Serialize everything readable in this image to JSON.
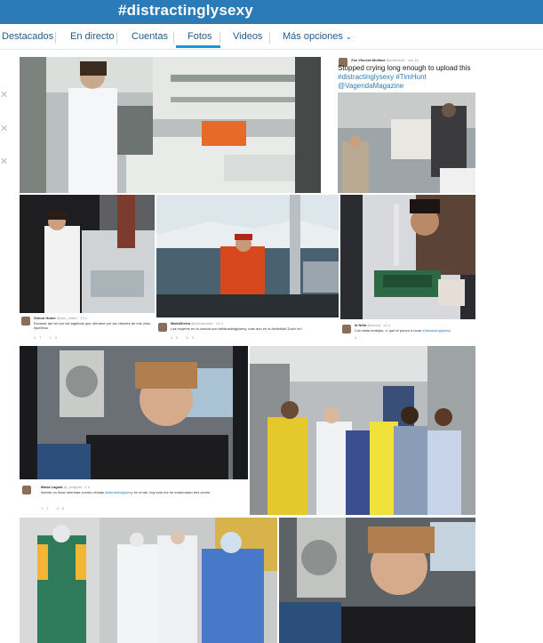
{
  "header": {
    "hashtag": "#distractinglysexy"
  },
  "tabs": [
    {
      "label": "Destacados"
    },
    {
      "label": "En directo"
    },
    {
      "label": "Cuentas"
    },
    {
      "label": "Fotos"
    },
    {
      "label": "Videos"
    },
    {
      "label": "Más opciones"
    }
  ],
  "active_tab": "Fotos",
  "gutter_icons": [
    "close-icon",
    "close-icon",
    "close-icon"
  ],
  "tweets": {
    "zoe": {
      "name": "Zoe Vincent-Mollase",
      "handle": "@zoebrenti · Jun 10",
      "text": "Stopped crying long enough to upload this",
      "tags": "#distractinglysexy #TimHunt",
      "mention": "@VagendaMagazine"
    },
    "simon": {
      "name": "Simon Huber",
      "handle": "@sim_huber · 13 h",
      "text": "Escaner tan bit con las lagrimas que derrame por las virtudes de mis virus hipefinos",
      "counts": "37  14"
    },
    "marta": {
      "name": "MartaSierra",
      "handle": "@sierramarta · 21 h",
      "text": "Las mujeres en la ciencia son #distractinglysexy, más aún en la Antártida! Doch on!",
      "counts": "46  53"
    },
    "la_nina": {
      "name": "la Niña",
      "handle": "@lanina · 21 h",
      "text": "Con tanta lentejas, a' que te ponen a tocar",
      "tag": "#distractinglysexy",
      "counts": "4"
    },
    "maria": {
      "name": "María Laguía",
      "handle": "@_mlaguia · 6 h",
      "text": "Intento no llorar mientras cuento células",
      "tag": "#distractinglysexy",
      "text2": "en el lab, hoy solo me he enamorado tres veces.",
      "counts": "17  36"
    }
  },
  "colors": {
    "header_bg": "#2b7bb9",
    "tab_text": "#1b5d90",
    "tab_active_underline": "#1b95e0",
    "link": "#2b7bb9"
  }
}
